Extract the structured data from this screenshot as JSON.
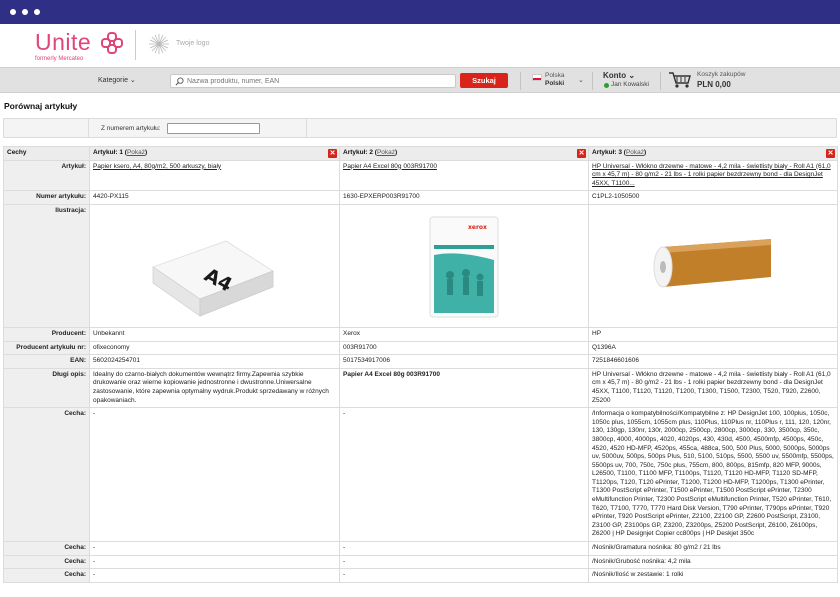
{
  "header": {
    "brand": "Unite",
    "brand_sub": "formerly Mercateo",
    "your_logo": "Twoje logo",
    "brand_color": "#e0457b"
  },
  "nav": {
    "categories": "Kategorie",
    "search_placeholder": "Nazwa produktu, numer, EAN",
    "search_button": "Szukaj",
    "country": "Polska",
    "language": "Polski",
    "account_title": "Konto",
    "account_user": "Jan Kowalski",
    "cart_title": "Koszyk zakupów",
    "cart_total": "PLN 0,00",
    "accent_color": "#d9241b"
  },
  "page_title": "Porównaj artykuły",
  "filter": {
    "label": "Z numerem artykułu:",
    "value": ""
  },
  "table": {
    "features_header": "Cechy",
    "columns": [
      {
        "title": "Artykuł: 1",
        "show": "Pokaż"
      },
      {
        "title": "Artykuł: 2",
        "show": "Pokaż"
      },
      {
        "title": "Artykuł: 3",
        "show": "Pokaż"
      }
    ],
    "rows": {
      "article_label": "Artykuł:",
      "article": [
        "Papier ksero, A4, 80g/m2, 500 arkuszy, biały",
        "Papier A4 Excel 80g 003R91700",
        "HP Universal - Włókno drzewne - matowe - 4,2 mila - świetlisty biały - Roll A1 (61,0 cm x 45,7 m) - 80 g/m2 - 21 lbs - 1 rolki papier bezdrzewny bond - dla DesignJet 45XX, T1100..."
      ],
      "number_label": "Numer artykułu:",
      "number": [
        "4420-PX115",
        "1630-EPXERP003R91700",
        "C1PL2-1050500"
      ],
      "illustration_label": "Ilustracja:",
      "illustration": [
        "a4-paper-ream",
        "xerox-excel-paper-pack",
        "paper-roll"
      ],
      "producer_label": "Producent:",
      "producer": [
        "Unbekannt",
        "Xerox",
        "HP"
      ],
      "producer_no_label": "Producent artykułu nr:",
      "producer_no": [
        "ofixeconomy",
        "003R91700",
        "Q1396A"
      ],
      "ean_label": "EAN:",
      "ean": [
        "5602024254701",
        "5017534917006",
        "7251846601606"
      ],
      "long_desc_label": "Długi opis:",
      "long_desc": [
        "Idealny do czarno-białych dokumentów wewnątrz firmy.Zapewnia szybkie drukowanie oraz wierne kopiowanie jednostronne i dwustronne.Uniwersalne zastosowanie, które zapewnia optymalny wydruk.Produkt sprzedawany w różnych opakowaniach.",
        "Papier A4 Excel 80g 003R91700",
        "HP Universal - Włókno drzewne - matowe - 4,2 mila - świetlisty biały - Roll A1 (61,0 cm x 45,7 m) - 80 g/m2 - 21 lbs - 1 rolki papier bezdrzewny bond - dla DesignJet 45XX, T1100, T1120, T1120, T1200, T1300, T1500, T2300, T520, T920, Z2600, Z5200"
      ],
      "feature_label": "Cecha:",
      "feature_main": [
        "-",
        "-",
        "/Informacja o kompatybilności/Kompatybilne z: HP DesignJet 100, 100plus, 1050c, 1050c plus, 1055cm, 1055cm plus, 110Plus, 110Plus nr, 110Plus r, 111, 120, 120nr, 130, 130gp, 130nr, 130r, 2000cp, 2500cp, 2800cp, 3000cp, 330, 3500cp, 350c, 3800cp, 4000, 4000ps, 4020, 4020ps, 430, 430d, 4500, 4500mfp, 4500ps, 450c, 4520, 4520 HD-MFP, 4520ps, 455ca, 488ca, 500, 500 Plus, 5000, 5000ps, 5000ps uv, 5000uv, 500ps, 500ps Plus, 510, 5100, 510ps, 5500, 5500 uv, 5500mfp, 5500ps, 5500ps uv, 700, 750c, 750c plus, 755cm, 800, 800ps, 815mfp, 820 MFP, 9000s, L26500, T1100, T1100 MFP, T1100ps, T1120, T1120 HD-MFP, T1120 SD-MFP, T1120ps, T120, T120 ePrinter, T1200, T1200 HD-MFP, T1200ps, T1300 ePrinter, T1300 PostScript ePrinter, T1500 ePrinter, T1500 PostScript ePrinter, T2300 eMultifunction Printer, T2300 PostScript eMultifunction Printer, T520 ePrinter, T610, T620, T7100, T770, T770 Hard Disk Version, T790 ePrinter, T790ps ePrinter, T920 ePrinter, T920 PostScript ePrinter, Z2100, Z2100 GP, Z2600 PostScript, Z3100, Z3100 GP, Z3100ps GP, Z3200, Z3200ps, Z5200 PostScript, Z6100, Z6100ps, Z6200 | HP Designjet Copier cc800ps | HP Deskjet 350c"
      ],
      "feature_2": [
        "-",
        "-",
        "/Nośnik/Gramatura nośnika: 80 g/m2 / 21 lbs"
      ],
      "feature_3": [
        "-",
        "-",
        "/Nośnik/Grubość nośnika: 4,2 mila"
      ],
      "feature_4": [
        "-",
        "-",
        "/Nośnik/Ilość w zestawie: 1 rolki"
      ]
    }
  }
}
